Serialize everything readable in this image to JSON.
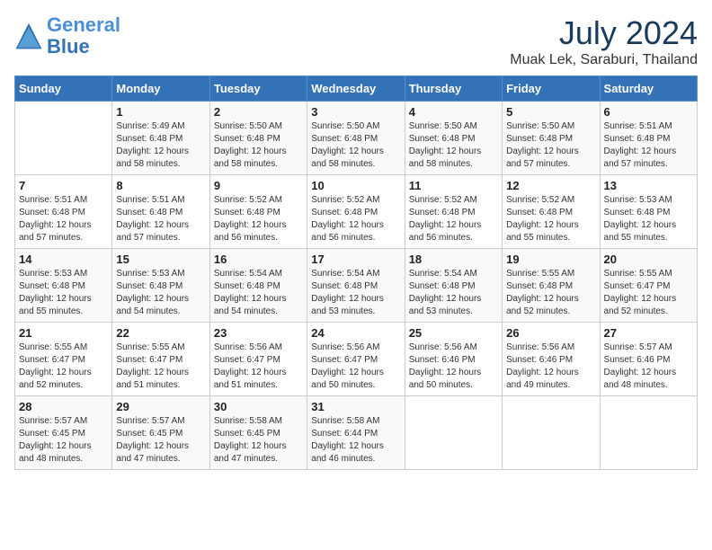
{
  "logo": {
    "line1": "General",
    "line2": "Blue"
  },
  "title": "July 2024",
  "location": "Muak Lek, Saraburi, Thailand",
  "header_days": [
    "Sunday",
    "Monday",
    "Tuesday",
    "Wednesday",
    "Thursday",
    "Friday",
    "Saturday"
  ],
  "weeks": [
    [
      {
        "day": "",
        "info": ""
      },
      {
        "day": "1",
        "info": "Sunrise: 5:49 AM\nSunset: 6:48 PM\nDaylight: 12 hours\nand 58 minutes."
      },
      {
        "day": "2",
        "info": "Sunrise: 5:50 AM\nSunset: 6:48 PM\nDaylight: 12 hours\nand 58 minutes."
      },
      {
        "day": "3",
        "info": "Sunrise: 5:50 AM\nSunset: 6:48 PM\nDaylight: 12 hours\nand 58 minutes."
      },
      {
        "day": "4",
        "info": "Sunrise: 5:50 AM\nSunset: 6:48 PM\nDaylight: 12 hours\nand 58 minutes."
      },
      {
        "day": "5",
        "info": "Sunrise: 5:50 AM\nSunset: 6:48 PM\nDaylight: 12 hours\nand 57 minutes."
      },
      {
        "day": "6",
        "info": "Sunrise: 5:51 AM\nSunset: 6:48 PM\nDaylight: 12 hours\nand 57 minutes."
      }
    ],
    [
      {
        "day": "7",
        "info": "Sunrise: 5:51 AM\nSunset: 6:48 PM\nDaylight: 12 hours\nand 57 minutes."
      },
      {
        "day": "8",
        "info": "Sunrise: 5:51 AM\nSunset: 6:48 PM\nDaylight: 12 hours\nand 57 minutes."
      },
      {
        "day": "9",
        "info": "Sunrise: 5:52 AM\nSunset: 6:48 PM\nDaylight: 12 hours\nand 56 minutes."
      },
      {
        "day": "10",
        "info": "Sunrise: 5:52 AM\nSunset: 6:48 PM\nDaylight: 12 hours\nand 56 minutes."
      },
      {
        "day": "11",
        "info": "Sunrise: 5:52 AM\nSunset: 6:48 PM\nDaylight: 12 hours\nand 56 minutes."
      },
      {
        "day": "12",
        "info": "Sunrise: 5:52 AM\nSunset: 6:48 PM\nDaylight: 12 hours\nand 55 minutes."
      },
      {
        "day": "13",
        "info": "Sunrise: 5:53 AM\nSunset: 6:48 PM\nDaylight: 12 hours\nand 55 minutes."
      }
    ],
    [
      {
        "day": "14",
        "info": "Sunrise: 5:53 AM\nSunset: 6:48 PM\nDaylight: 12 hours\nand 55 minutes."
      },
      {
        "day": "15",
        "info": "Sunrise: 5:53 AM\nSunset: 6:48 PM\nDaylight: 12 hours\nand 54 minutes."
      },
      {
        "day": "16",
        "info": "Sunrise: 5:54 AM\nSunset: 6:48 PM\nDaylight: 12 hours\nand 54 minutes."
      },
      {
        "day": "17",
        "info": "Sunrise: 5:54 AM\nSunset: 6:48 PM\nDaylight: 12 hours\nand 53 minutes."
      },
      {
        "day": "18",
        "info": "Sunrise: 5:54 AM\nSunset: 6:48 PM\nDaylight: 12 hours\nand 53 minutes."
      },
      {
        "day": "19",
        "info": "Sunrise: 5:55 AM\nSunset: 6:48 PM\nDaylight: 12 hours\nand 52 minutes."
      },
      {
        "day": "20",
        "info": "Sunrise: 5:55 AM\nSunset: 6:47 PM\nDaylight: 12 hours\nand 52 minutes."
      }
    ],
    [
      {
        "day": "21",
        "info": "Sunrise: 5:55 AM\nSunset: 6:47 PM\nDaylight: 12 hours\nand 52 minutes."
      },
      {
        "day": "22",
        "info": "Sunrise: 5:55 AM\nSunset: 6:47 PM\nDaylight: 12 hours\nand 51 minutes."
      },
      {
        "day": "23",
        "info": "Sunrise: 5:56 AM\nSunset: 6:47 PM\nDaylight: 12 hours\nand 51 minutes."
      },
      {
        "day": "24",
        "info": "Sunrise: 5:56 AM\nSunset: 6:47 PM\nDaylight: 12 hours\nand 50 minutes."
      },
      {
        "day": "25",
        "info": "Sunrise: 5:56 AM\nSunset: 6:46 PM\nDaylight: 12 hours\nand 50 minutes."
      },
      {
        "day": "26",
        "info": "Sunrise: 5:56 AM\nSunset: 6:46 PM\nDaylight: 12 hours\nand 49 minutes."
      },
      {
        "day": "27",
        "info": "Sunrise: 5:57 AM\nSunset: 6:46 PM\nDaylight: 12 hours\nand 48 minutes."
      }
    ],
    [
      {
        "day": "28",
        "info": "Sunrise: 5:57 AM\nSunset: 6:45 PM\nDaylight: 12 hours\nand 48 minutes."
      },
      {
        "day": "29",
        "info": "Sunrise: 5:57 AM\nSunset: 6:45 PM\nDaylight: 12 hours\nand 47 minutes."
      },
      {
        "day": "30",
        "info": "Sunrise: 5:58 AM\nSunset: 6:45 PM\nDaylight: 12 hours\nand 47 minutes."
      },
      {
        "day": "31",
        "info": "Sunrise: 5:58 AM\nSunset: 6:44 PM\nDaylight: 12 hours\nand 46 minutes."
      },
      {
        "day": "",
        "info": ""
      },
      {
        "day": "",
        "info": ""
      },
      {
        "day": "",
        "info": ""
      }
    ]
  ]
}
